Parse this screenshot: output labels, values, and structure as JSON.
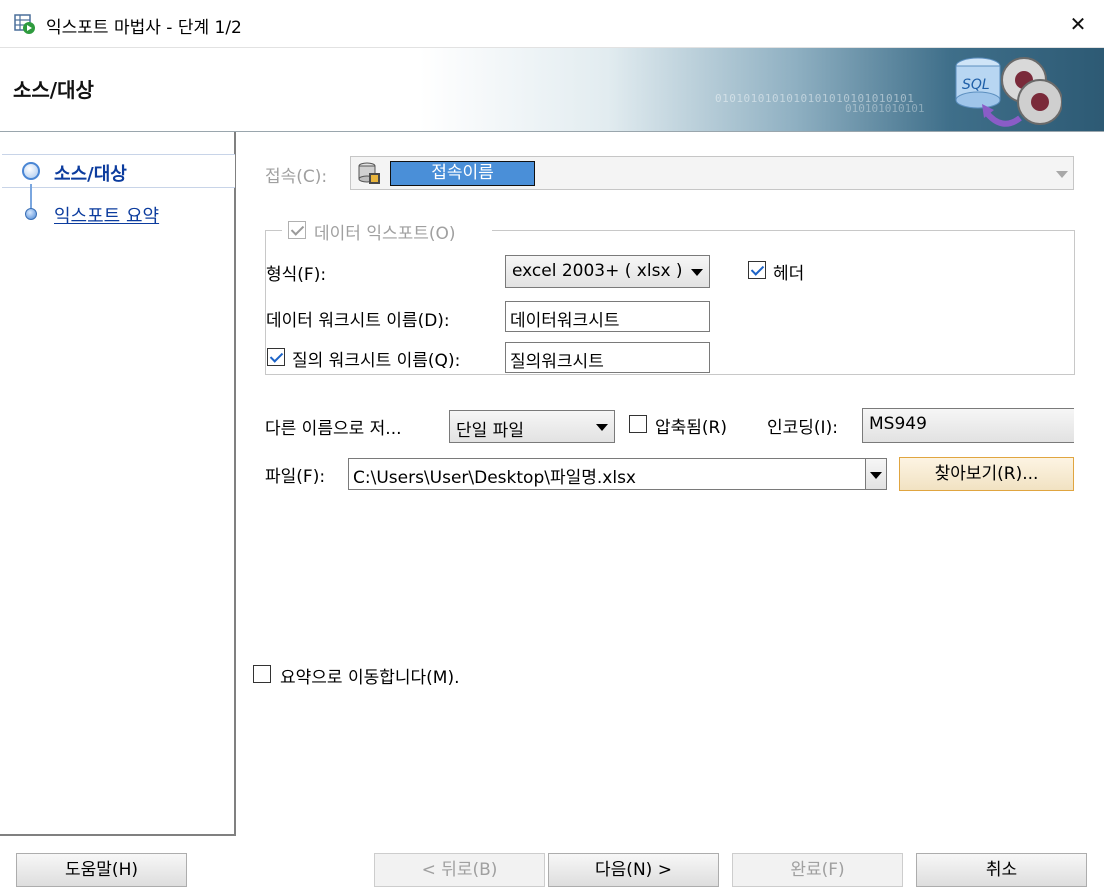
{
  "window": {
    "title": "익스포트 마법사 - 단계 1/2",
    "close_symbol": "✕"
  },
  "banner": {
    "title": "소스/대상",
    "binary_text": "0101010101010101010101010101",
    "binary_text_2": "010101010101",
    "graphic_label": "SQL"
  },
  "nav": {
    "items": [
      {
        "label": "소스/대상",
        "selected": true
      },
      {
        "label": "익스포트 요약",
        "selected": false
      }
    ]
  },
  "connection": {
    "label": "접속(C):",
    "value": "접속이름"
  },
  "export_group": {
    "title": "데이터 익스포트(O)",
    "checked": true,
    "format_label": "형식(F):",
    "format_value": "excel 2003+ ( xlsx )",
    "header_label": "헤더",
    "header_checked": true,
    "data_sheet_label": "데이터 워크시트 이름(D):",
    "data_sheet_value": "데이터워크시트",
    "query_sheet_label": "질의 워크시트 이름(Q):",
    "query_sheet_checked": true,
    "query_sheet_value": "질의워크시트"
  },
  "save": {
    "label": "다른 이름으로 저...",
    "mode_value": "단일 파일",
    "compressed_label": "압축됨(R)",
    "compressed_checked": false,
    "encoding_label": "인코딩(I):",
    "encoding_value": "MS949"
  },
  "file": {
    "label": "파일(F):",
    "value": "C:\\Users\\User\\Desktop\\파일명.xlsx",
    "browse_label": "찾아보기(R)..."
  },
  "goto_summary": {
    "label": "요약으로 이동합니다(M).",
    "checked": false
  },
  "buttons": {
    "help": "도움말(H)",
    "back": "< 뒤로(B)",
    "next": "다음(N) >",
    "finish": "완료(F)",
    "cancel": "취소"
  }
}
